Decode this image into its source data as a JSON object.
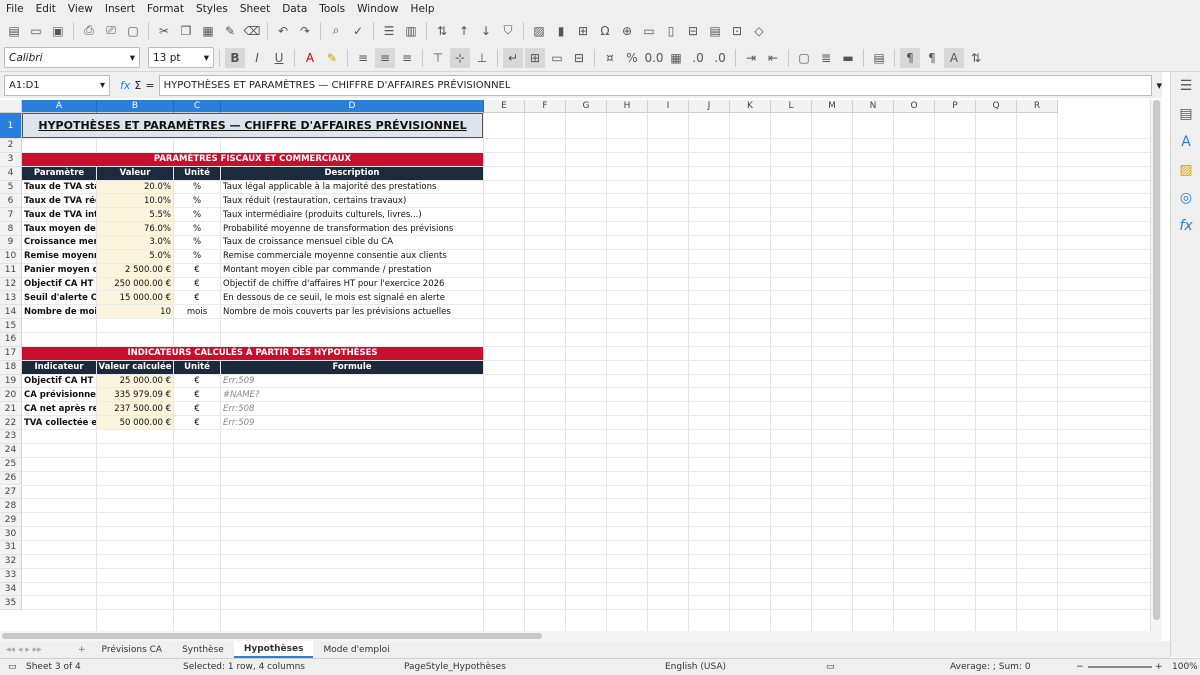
{
  "menu": [
    "File",
    "Edit",
    "View",
    "Insert",
    "Format",
    "Styles",
    "Sheet",
    "Data",
    "Tools",
    "Window",
    "Help"
  ],
  "toolbar": {
    "font_name": "Calibri",
    "font_size": "13 pt",
    "bold": "B",
    "italic": "I",
    "underline": "U"
  },
  "formula_bar": {
    "name_box": "A1:D1",
    "fx": "fx",
    "sigma": "Σ",
    "eq": "=",
    "content": "HYPOTHÈSES ET PARAMÈTRES — CHIFFRE D'AFFAIRES PRÉVISIONNEL"
  },
  "columns": [
    "A",
    "B",
    "C",
    "D",
    "E",
    "F",
    "G",
    "H",
    "I",
    "J",
    "K",
    "L",
    "M",
    "N",
    "O",
    "P",
    "Q",
    "R"
  ],
  "rows": [
    "1",
    "2",
    "3",
    "4",
    "5",
    "6",
    "7",
    "8",
    "9",
    "10",
    "11",
    "12",
    "13",
    "14",
    "15",
    "16",
    "17",
    "18",
    "19",
    "20",
    "21",
    "22",
    "23",
    "24",
    "25",
    "26",
    "27",
    "28",
    "29",
    "30",
    "31",
    "32",
    "33",
    "34",
    "35"
  ],
  "sheet": {
    "title": "HYPOTHÈSES ET PARAMÈTRES — CHIFFRE D'AFFAIRES PRÉVISIONNEL",
    "section1": "PARAMÈTRES FISCAUX ET COMMERCIAUX",
    "headers1": [
      "Paramètre",
      "Valeur",
      "Unité",
      "Description"
    ],
    "params": [
      {
        "name": "Taux de TVA standard",
        "value": "20.0%",
        "unit": "%",
        "desc": "Taux légal applicable à la majorité des prestations"
      },
      {
        "name": "Taux de TVA réduit",
        "value": "10.0%",
        "unit": "%",
        "desc": "Taux réduit (restauration, certains travaux)"
      },
      {
        "name": "Taux de TVA intermédiaire",
        "value": "5.5%",
        "unit": "%",
        "desc": "Taux intermédiaire (produits culturels, livres...)"
      },
      {
        "name": "Taux moyen de réalisation",
        "value": "76.0%",
        "unit": "%",
        "desc": "Probabilité moyenne de transformation des prévisions"
      },
      {
        "name": "Croissance mensuelle attendue",
        "value": "3.0%",
        "unit": "%",
        "desc": "Taux de croissance mensuel cible du CA"
      },
      {
        "name": "Remise moyenne accordée",
        "value": "5.0%",
        "unit": "%",
        "desc": "Remise commerciale moyenne consentie aux clients"
      },
      {
        "name": "Panier moyen cible",
        "value": "2 500.00 €",
        "unit": "€",
        "desc": "Montant moyen cible par commande / prestation"
      },
      {
        "name": "Objectif CA HT annuel",
        "value": "250 000.00 €",
        "unit": "€",
        "desc": "Objectif de chiffre d'affaires HT pour l'exercice 2026"
      },
      {
        "name": "Seuil d'alerte CA mensuel",
        "value": "15 000.00 €",
        "unit": "€",
        "desc": "En dessous de ce seuil, le mois est signalé en alerte"
      },
      {
        "name": "Nombre de mois actifs",
        "value": "10",
        "unit": "mois",
        "desc": "Nombre de mois couverts par les prévisions actuelles"
      }
    ],
    "section2": "INDICATEURS CALCULÉS À PARTIR DES HYPOTHÈSES",
    "headers2": [
      "Indicateur",
      "Valeur calculée",
      "Unité",
      "Formule"
    ],
    "indicators": [
      {
        "name": "Objectif CA HT mensuel moyen",
        "value": "25 000.00 €",
        "unit": "€",
        "formula": "Err:509"
      },
      {
        "name": "CA prévisionnel avec croissance",
        "value": "335 979.09 €",
        "unit": "€",
        "formula": "#NAME?"
      },
      {
        "name": "CA net après remise moyenne",
        "value": "237 500.00 €",
        "unit": "€",
        "formula": "Err:508"
      },
      {
        "name": "TVA collectée estimée",
        "value": "50 000.00 €",
        "unit": "€",
        "formula": "Err:509"
      }
    ]
  },
  "tabs": [
    "Prévisions CA",
    "Synthèse",
    "Hypothèses",
    "Mode d'emploi"
  ],
  "active_tab": "Hypothèses",
  "status": {
    "sheet": "Sheet 3 of 4",
    "selection": "Selected: 1 row, 4 columns",
    "page_style": "PageStyle_Hypothèses",
    "language": "English (USA)",
    "sum": "Average: ; Sum: 0",
    "zoom": "100%"
  },
  "colors": {
    "accent_red": "#c8102e",
    "header_navy": "#1c2a3e",
    "value_fill": "#fbf4dc",
    "selection": "#2a7fdb"
  }
}
